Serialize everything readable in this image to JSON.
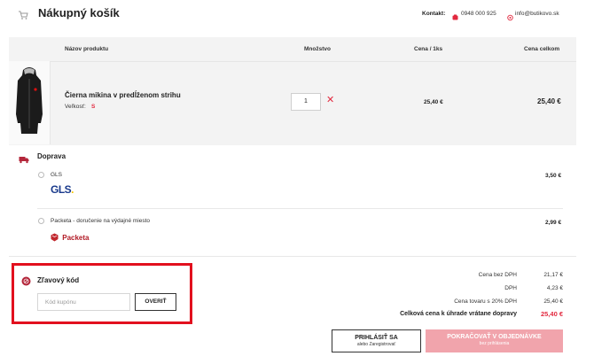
{
  "header": {
    "title": "Nákupný košík",
    "contact_label": "Kontakt:",
    "phone": "0948 000 925",
    "email": "info@butikovo.sk"
  },
  "table": {
    "columns": [
      "Názov produktu",
      "Množstvo",
      "Cena / 1ks",
      "Cena celkom"
    ]
  },
  "product": {
    "name": "Čierna mikina v predĺženom strihu",
    "size_label": "Veľkosť:",
    "size_value": "S",
    "quantity": "1",
    "unit_price": "25,40 €",
    "total_price": "25,40 €"
  },
  "shipping": {
    "title": "Doprava",
    "options": [
      {
        "label": "GLS",
        "price": "3,50 €",
        "logo": "GLS"
      },
      {
        "label": "Packeta - doručenie na výdajné miesto",
        "price": "2,99 €",
        "logo": "Packeta"
      }
    ]
  },
  "discount": {
    "title": "Zľavový kód",
    "placeholder": "Kód kupónu",
    "verify_label": "OVERIŤ"
  },
  "summary": {
    "rows": [
      {
        "label": "Cena bez DPH",
        "value": "21,17 €"
      },
      {
        "label": "DPH",
        "value": "4,23 €"
      },
      {
        "label": "Cena tovaru s 20% DPH",
        "value": "25,40 €"
      }
    ],
    "total_label": "Celková cena k úhrade vrátane dopravy",
    "total_value": "25,40 €"
  },
  "actions": {
    "login_label": "PRIHLÁSIŤ SA",
    "login_sub": "alebo Zaregistrovať",
    "continue_label": "POKRAČOVAŤ V OBJEDNÁVKE",
    "continue_sub": "bez prihlásenia"
  },
  "colors": {
    "accent": "#e2293f",
    "highlight": "#e2101e",
    "continue_bg": "#f1a4ac"
  }
}
